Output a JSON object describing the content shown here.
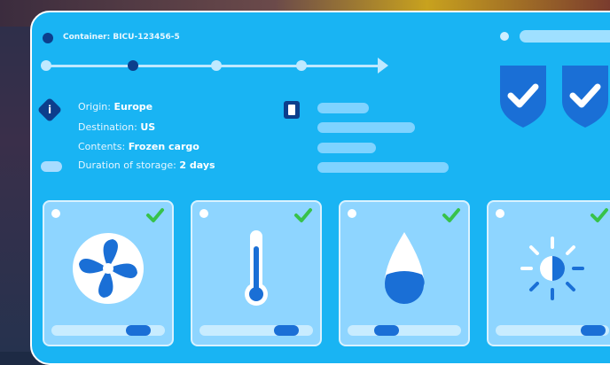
{
  "header": {
    "container_label": "Container: BICU-123456-5"
  },
  "progress": {
    "steps": 5,
    "active_step": 2
  },
  "info": {
    "origin_label": "Origin:",
    "origin_value": "Europe",
    "destination_label": "Destination:",
    "destination_value": "US",
    "contents_label": "Contents:",
    "contents_value": "Frozen cargo",
    "duration_label": "Duration of storage:",
    "duration_value": "2 days"
  },
  "cards": [
    {
      "icon": "fan-icon",
      "status": "check-icon",
      "slider_level": 0.75
    },
    {
      "icon": "thermometer-icon",
      "status": "check-icon",
      "slider_level": 0.7
    },
    {
      "icon": "water-drop-icon",
      "status": "check-icon",
      "slider_level": 0.3
    },
    {
      "icon": "sun-icon",
      "status": "check-icon",
      "slider_level": 0.85
    }
  ],
  "shields": [
    "shield-check-icon",
    "shield-check-icon"
  ],
  "colors": {
    "panel": "#19b4f3",
    "card": "#8ed5ff",
    "dark_blue": "#0c3e8c",
    "icon_blue": "#1a6fd6",
    "check_green": "#37c24a"
  }
}
